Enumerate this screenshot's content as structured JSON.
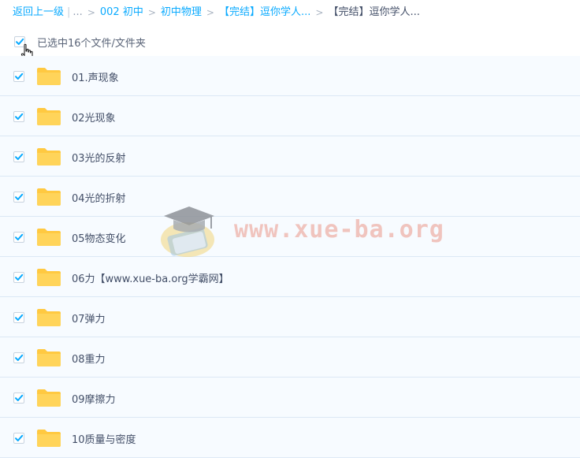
{
  "breadcrumb": {
    "back_label": "返回上一级",
    "ellipsis": "...",
    "separator": ">",
    "crumbs": [
      "002 初中",
      "初中物理",
      "【完结】逗你学人..."
    ],
    "current": "【完结】逗你学人..."
  },
  "selection": {
    "label": "已选中16个文件/文件夹",
    "all_checked": true
  },
  "files": [
    {
      "name": "01.声现象",
      "checked": true
    },
    {
      "name": "02光现象",
      "checked": true
    },
    {
      "name": "03光的反射",
      "checked": true
    },
    {
      "name": "04光的折射",
      "checked": true
    },
    {
      "name": "05物态变化",
      "checked": true
    },
    {
      "name": "06力【www.xue-ba.org学霸网】",
      "checked": true
    },
    {
      "name": "07弹力",
      "checked": true
    },
    {
      "name": "08重力",
      "checked": true
    },
    {
      "name": "09摩擦力",
      "checked": true
    },
    {
      "name": "10质量与密度",
      "checked": true
    }
  ],
  "watermark": {
    "text": "www.xue-ba.org",
    "icon": "graduation-cap-icon"
  },
  "colors": {
    "link": "#09aaff",
    "check": "#09aaff",
    "folder": "#ffc941",
    "row_bg": "#f7fbff",
    "divider": "#dbe8f5"
  }
}
